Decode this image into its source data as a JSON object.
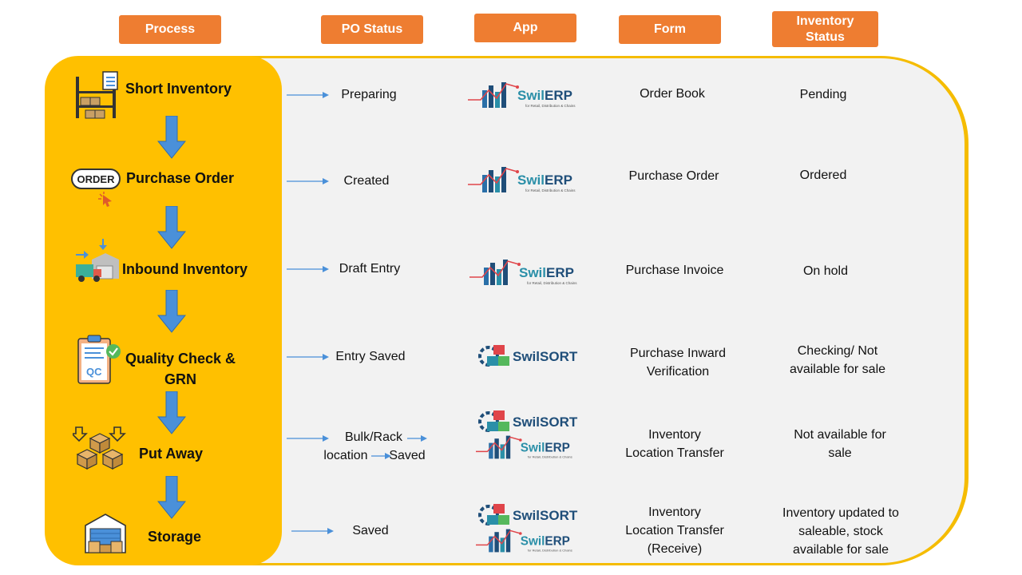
{
  "headers": {
    "process": "Process",
    "po_status": "PO Status",
    "app": "App",
    "form": "Form",
    "inventory_status_line1": "Inventory",
    "inventory_status_line2": "Status"
  },
  "rows": [
    {
      "process": "Short Inventory",
      "po_status": "Preparing",
      "app": [
        "SwilERP"
      ],
      "form": [
        "Order Book"
      ],
      "inventory": [
        "Pending"
      ]
    },
    {
      "process": "Purchase Order",
      "po_status": "Created",
      "app": [
        "SwilERP"
      ],
      "form": [
        "Purchase Order"
      ],
      "inventory": [
        "Ordered"
      ]
    },
    {
      "process": "Inbound Inventory",
      "po_status": "Draft Entry",
      "app": [
        "SwilERP"
      ],
      "form": [
        "Purchase Invoice"
      ],
      "inventory": [
        "On hold"
      ]
    },
    {
      "process_line1": "Quality Check &",
      "process_line2": "GRN",
      "po_status": "Entry Saved",
      "app": [
        "SwilSORT"
      ],
      "form": [
        "Purchase Inward",
        "Verification"
      ],
      "inventory": [
        "Checking/ Not",
        "available for sale"
      ]
    },
    {
      "process": "Put Away",
      "po_status_a": "Bulk/Rack",
      "po_status_b": "location",
      "po_status_c": "Saved",
      "app": [
        "SwilSORT",
        "SwilERP"
      ],
      "form": [
        "Inventory",
        "Location Transfer"
      ],
      "inventory": [
        "Not available for",
        "sale"
      ]
    },
    {
      "process": "Storage",
      "po_status": "Saved",
      "app": [
        "SwilSORT",
        "SwilERP"
      ],
      "form": [
        "Inventory",
        "Location Transfer",
        "(Receive)"
      ],
      "inventory": [
        "Inventory updated to",
        "saleable, stock",
        "available for sale"
      ]
    }
  ],
  "logo": {
    "erp_prefix": "Swil",
    "erp_suffix": "ERP",
    "erp_tagline": "for Retail, Distribution & Chains",
    "sort_prefix": "Swil",
    "sort_suffix": "SORT"
  },
  "icons": {
    "order_badge": "ORDER",
    "qc_badge": "QC"
  },
  "colors": {
    "header": "#EE7D31",
    "process_panel": "#FFC000",
    "panel_border": "#F5BC00",
    "panel_bg": "#F2F2F2",
    "arrow": "#4A90D9"
  }
}
